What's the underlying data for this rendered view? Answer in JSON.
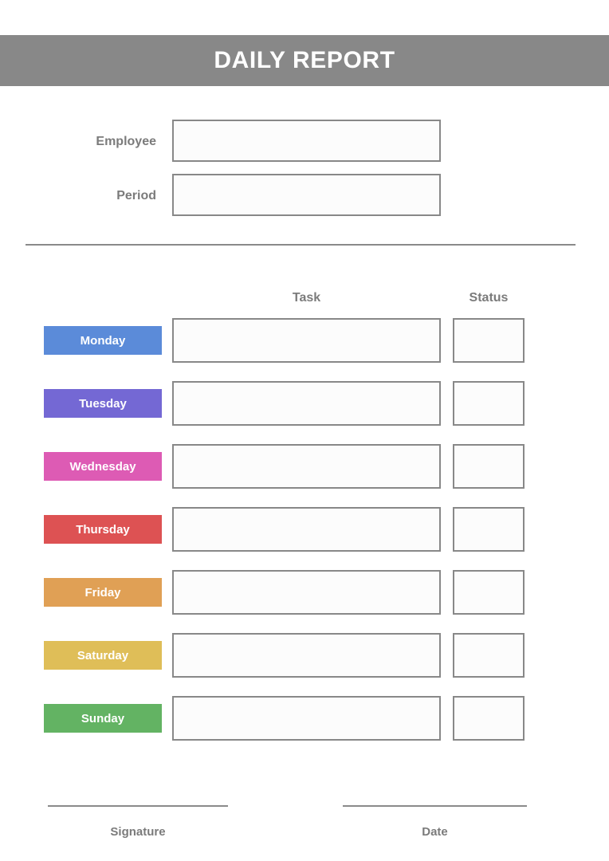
{
  "header": {
    "title": "DAILY REPORT",
    "band_color": "#888888",
    "title_color": "#ffffff"
  },
  "meta": {
    "fields": [
      {
        "label": "Employee",
        "value": "",
        "placeholder": ""
      },
      {
        "label": "Period",
        "value": "",
        "placeholder": ""
      }
    ]
  },
  "table": {
    "columns": [
      {
        "key": "task",
        "header": "Task"
      },
      {
        "key": "status",
        "header": "Status"
      }
    ],
    "rows": [
      {
        "day": "Monday",
        "color": "#5b8bd9",
        "task": "",
        "status": ""
      },
      {
        "day": "Tuesday",
        "color": "#7468d4",
        "task": "",
        "status": ""
      },
      {
        "day": "Wednesday",
        "color": "#dd5bb4",
        "task": "",
        "status": ""
      },
      {
        "day": "Thursday",
        "color": "#dd5253",
        "task": "",
        "status": ""
      },
      {
        "day": "Friday",
        "color": "#e0a055",
        "task": "",
        "status": ""
      },
      {
        "day": "Saturday",
        "color": "#dfbe58",
        "task": "",
        "status": ""
      },
      {
        "day": "Sunday",
        "color": "#63b363",
        "task": "",
        "status": ""
      }
    ]
  },
  "footer": {
    "signature_label": "Signature",
    "date_label": "Date"
  },
  "theme": {
    "background": "#ffffff",
    "text_gray": "#7b7b7b",
    "border_gray": "#888888",
    "field_fill": "#fcfcfc"
  }
}
